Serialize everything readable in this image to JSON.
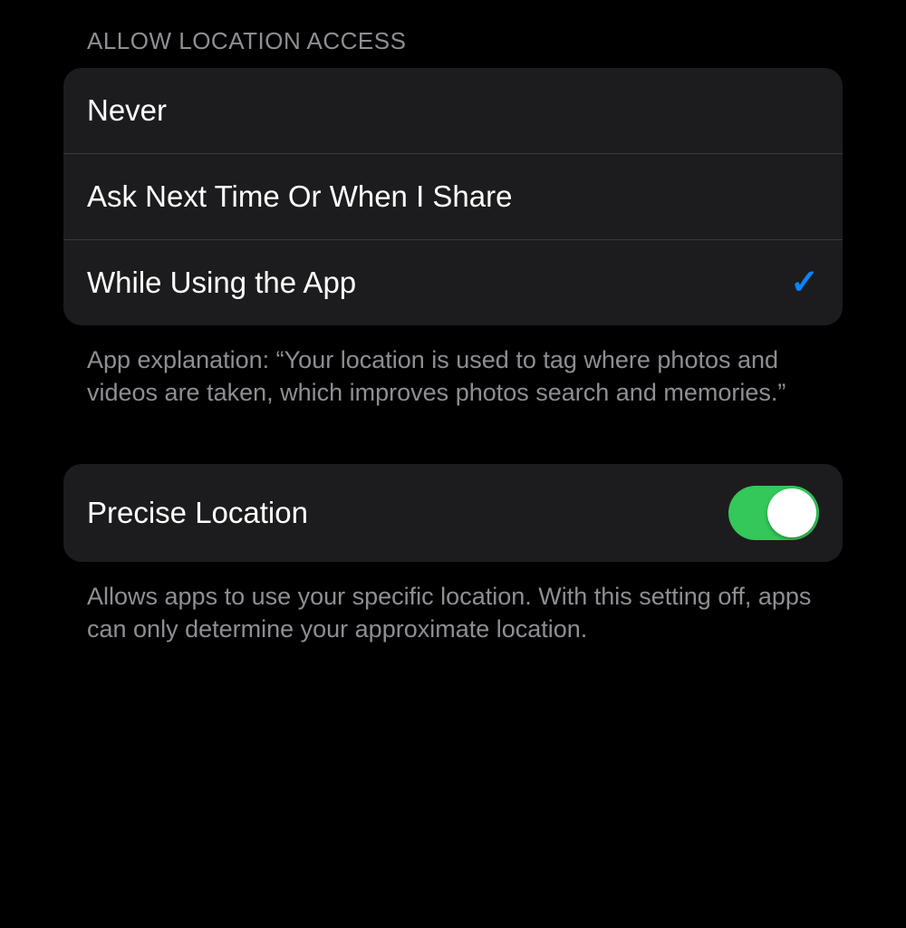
{
  "allow_location": {
    "header": "ALLOW LOCATION ACCESS",
    "options": [
      {
        "label": "Never",
        "selected": false
      },
      {
        "label": "Ask Next Time Or When I Share",
        "selected": false
      },
      {
        "label": "While Using the App",
        "selected": true
      }
    ],
    "footer": "App explanation: “Your location is used to tag where photos and videos are taken, which improves photos search and memories.”"
  },
  "precise_location": {
    "label": "Precise Location",
    "enabled": true,
    "footer": "Allows apps to use your specific location. With this setting off, apps can only determine your approximate location."
  },
  "colors": {
    "accent": "#0a84ff",
    "toggle_on": "#34c759"
  }
}
